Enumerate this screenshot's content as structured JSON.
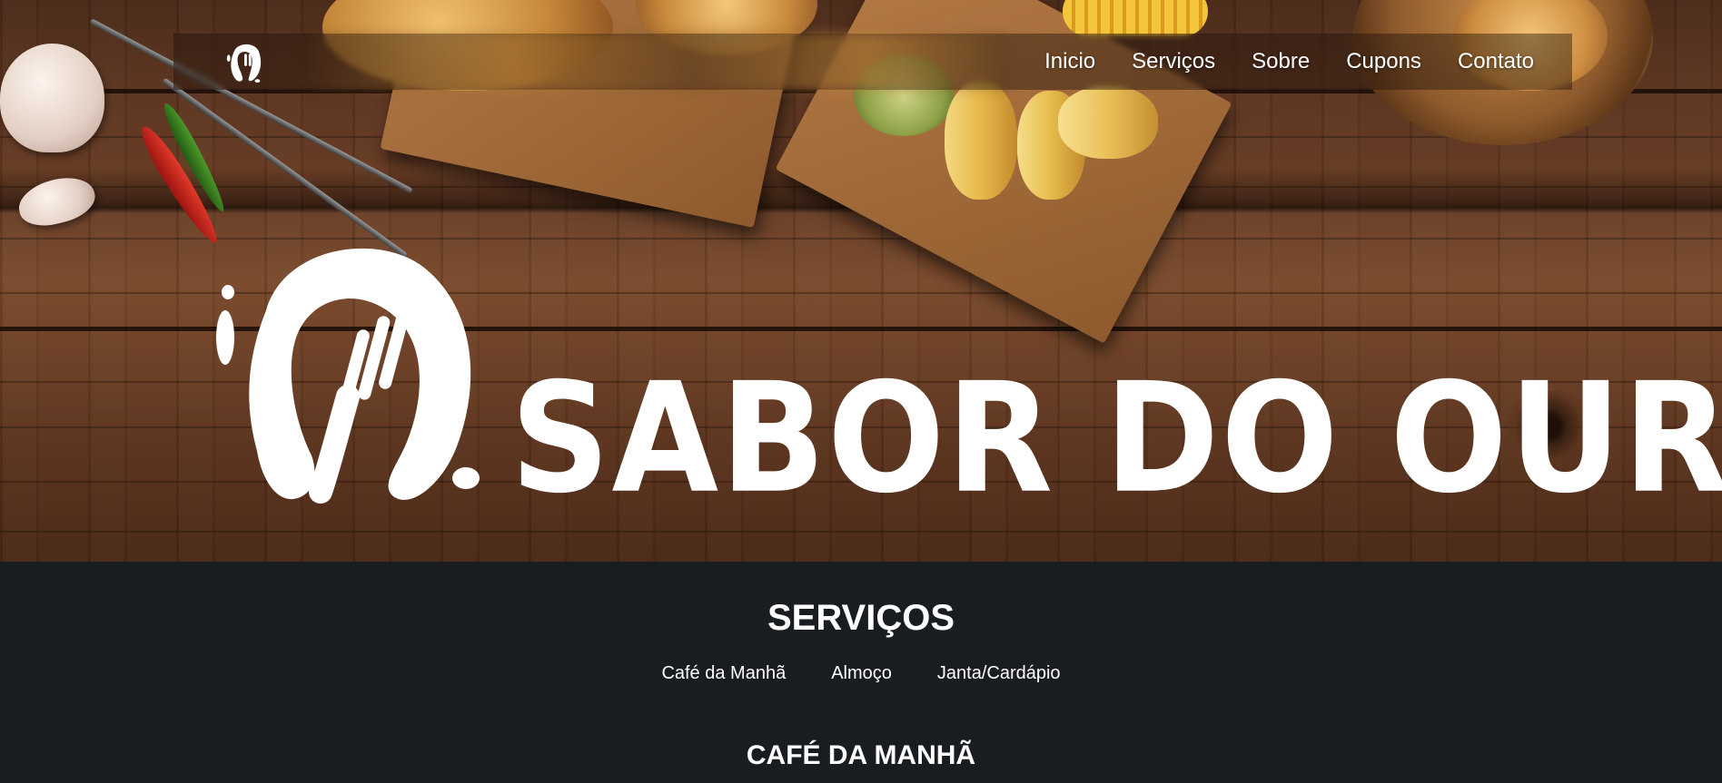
{
  "brand": {
    "name": "SABOR DO OURO",
    "logo_icon": "plate-fork-icon"
  },
  "nav": {
    "items": [
      {
        "label": "Inicio"
      },
      {
        "label": "Serviços"
      },
      {
        "label": "Sobre"
      },
      {
        "label": "Cupons"
      },
      {
        "label": "Contato"
      }
    ]
  },
  "services": {
    "title": "SERVIÇOS",
    "tabs": [
      {
        "label": "Café da Manhã"
      },
      {
        "label": "Almoço"
      },
      {
        "label": "Janta/Cardápio"
      }
    ],
    "current_section": "CAFÉ DA MANHÃ"
  },
  "colors": {
    "background_dark": "#191c20",
    "text": "#ffffff",
    "wood": "#6b3f25"
  }
}
